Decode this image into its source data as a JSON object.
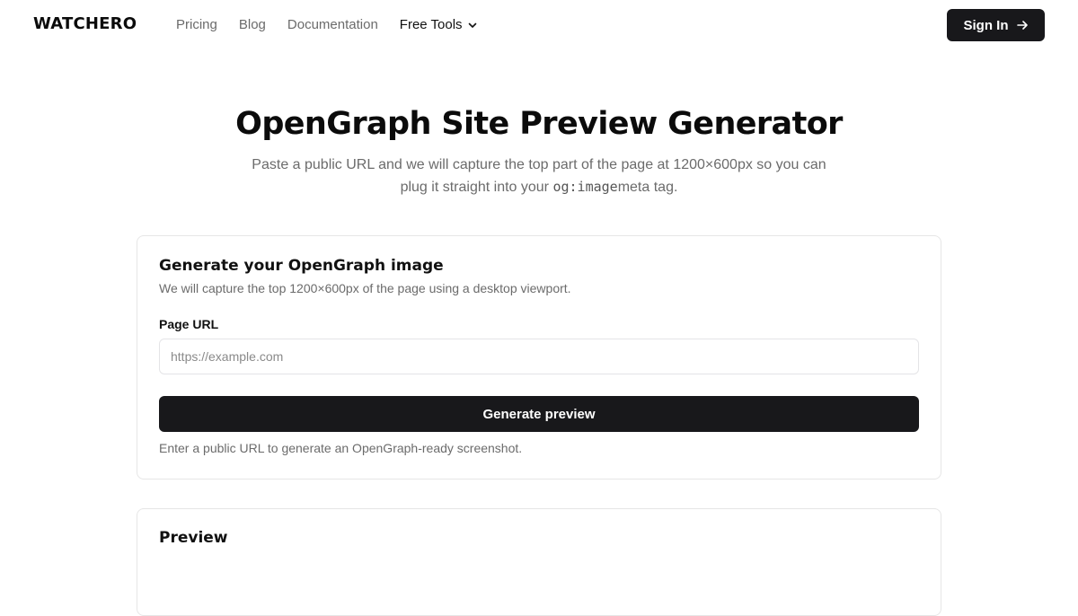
{
  "header": {
    "logo": "WATCHERO",
    "nav": [
      {
        "label": "Pricing"
      },
      {
        "label": "Blog"
      },
      {
        "label": "Documentation"
      },
      {
        "label": "Free Tools",
        "icon": "chevron-down-icon"
      }
    ],
    "sign_in_label": "Sign In",
    "sign_in_icon": "arrow-right-icon"
  },
  "hero": {
    "title": "OpenGraph Site Preview Generator",
    "subtitle_part1": "Paste a public URL and we will capture the top part of the page at 1200×600px so you can plug it straight into your ",
    "subtitle_code": "og:image",
    "subtitle_part2": "meta tag."
  },
  "form_card": {
    "title": "Generate your OpenGraph image",
    "description": "We will capture the top 1200×600px of the page using a desktop viewport.",
    "url_label": "Page URL",
    "url_placeholder": "https://example.com",
    "url_value": "",
    "button_label": "Generate preview",
    "helper_text": "Enter a public URL to generate an OpenGraph-ready screenshot."
  },
  "preview_card": {
    "title": "Preview"
  },
  "colors": {
    "primary_button": "#18181b",
    "muted_text": "#6b6b6b",
    "border": "#e6e6e6"
  }
}
